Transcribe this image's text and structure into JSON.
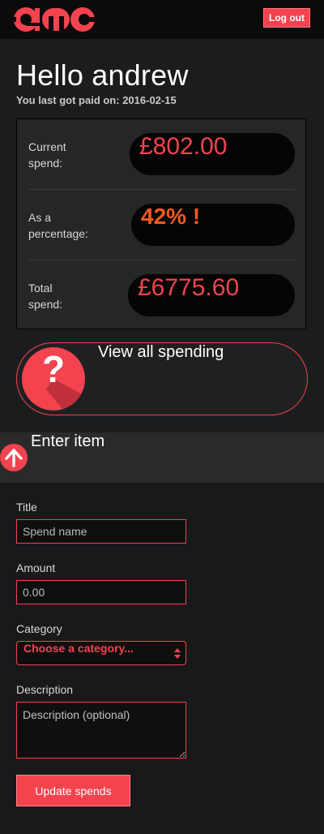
{
  "header": {
    "logo_text": "amc",
    "logout_label": "Log out"
  },
  "greeting": {
    "title": "Hello andrew",
    "last_paid": "You last got paid on: 2016-02-15"
  },
  "stats": [
    {
      "label_line1": "Current",
      "label_line2": "spend:",
      "value": "£802.00"
    },
    {
      "label_line1": "As a",
      "label_line2": "percentage:",
      "value": "42% !"
    },
    {
      "label_line1": "Total",
      "label_line2": "spend:",
      "value": "£6775.60"
    }
  ],
  "view_all": {
    "icon": "question-icon",
    "glyph": "?",
    "label": "View all spending"
  },
  "enter_item": {
    "icon": "arrow-up-icon",
    "title": "Enter item"
  },
  "form": {
    "title_label": "Title",
    "title_placeholder": "Spend name",
    "amount_label": "Amount",
    "amount_placeholder": "0.00",
    "category_label": "Category",
    "category_selected": "Choose a category...",
    "description_label": "Description",
    "description_placeholder": "Description (optional)",
    "submit_label": "Update spends"
  },
  "colors": {
    "accent": "#f2434f",
    "percentage": "#f25a1a",
    "background": "#1b1c1e"
  }
}
